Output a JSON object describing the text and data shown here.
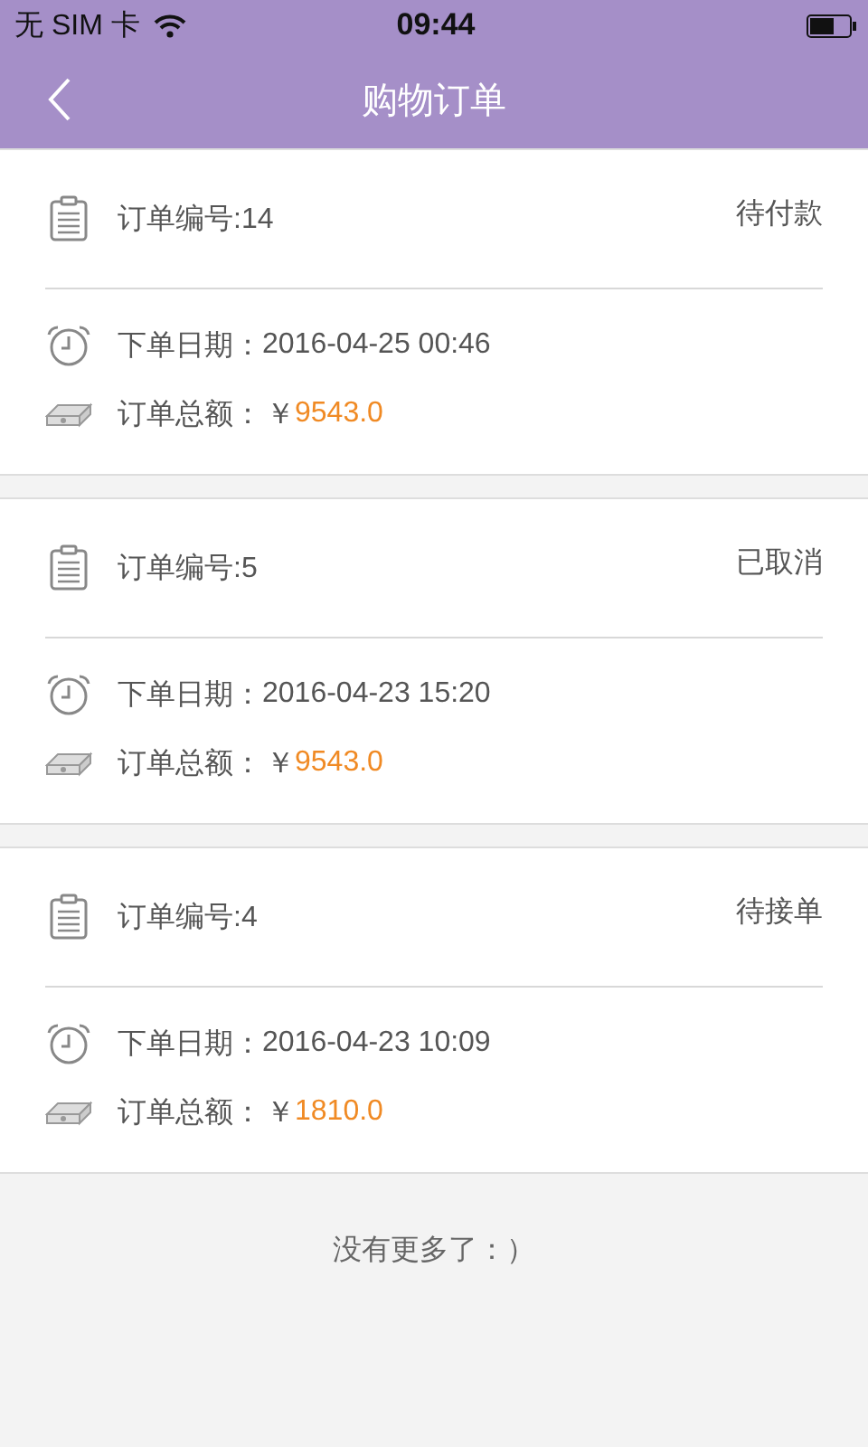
{
  "status_bar": {
    "carrier": "无 SIM 卡",
    "time": "09:44"
  },
  "nav": {
    "title": "购物订单"
  },
  "orders": [
    {
      "number": "订单编号:14",
      "status": "待付款",
      "date_label": "下单日期：",
      "date": "2016-04-25 00:46",
      "amount_label": "订单总额：",
      "currency": "￥",
      "amount": "9543.0"
    },
    {
      "number": "订单编号:5",
      "status": "已取消",
      "date_label": "下单日期：",
      "date": "2016-04-23 15:20",
      "amount_label": "订单总额：",
      "currency": "￥",
      "amount": "9543.0"
    },
    {
      "number": "订单编号:4",
      "status": "待接单",
      "date_label": "下单日期：",
      "date": "2016-04-23 10:09",
      "amount_label": "订单总额：",
      "currency": "￥",
      "amount": "1810.0"
    }
  ],
  "footer": "没有更多了：）"
}
